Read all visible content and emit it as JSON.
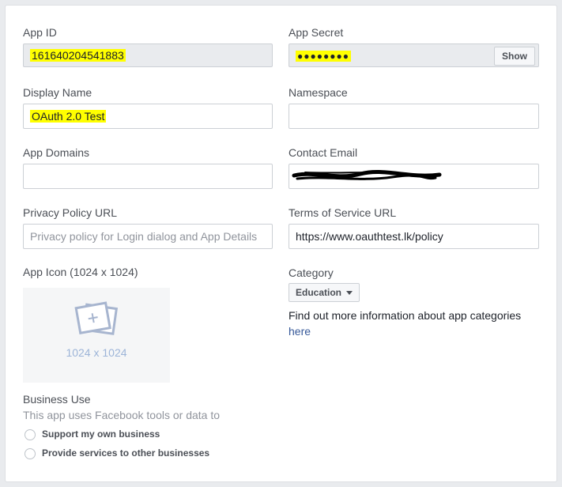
{
  "app_id": {
    "label": "App ID",
    "value": "161640204541883"
  },
  "app_secret": {
    "label": "App Secret",
    "value": "●●●●●●●●",
    "show_label": "Show"
  },
  "display_name": {
    "label": "Display Name",
    "value": "OAuth 2.0 Test"
  },
  "namespace": {
    "label": "Namespace",
    "value": ""
  },
  "app_domains": {
    "label": "App Domains",
    "value": ""
  },
  "contact_email": {
    "label": "Contact Email",
    "value": ""
  },
  "privacy_policy": {
    "label": "Privacy Policy URL",
    "placeholder": "Privacy policy for Login dialog and App Details"
  },
  "terms_of_service": {
    "label": "Terms of Service URL",
    "value": "https://www.oauthtest.lk/policy"
  },
  "app_icon": {
    "label": "App Icon (1024 x 1024)",
    "size_text": "1024 x 1024"
  },
  "category": {
    "label": "Category",
    "selected": "Education",
    "info_text": "Find out more information about app categories",
    "link_text": "here"
  },
  "business_use": {
    "label": "Business Use",
    "description": "This app uses Facebook tools or data to",
    "options": [
      "Support my own business",
      "Provide services to other businesses"
    ]
  },
  "colors": {
    "highlight": "#ffff00",
    "link": "#365899",
    "border": "#ccd0d5"
  }
}
